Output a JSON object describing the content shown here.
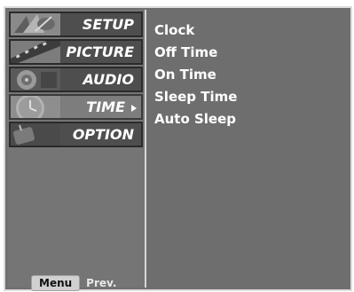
{
  "menu": {
    "items": [
      {
        "label": "SETUP",
        "icon": "satellite-dish-icon",
        "selected": false
      },
      {
        "label": "PICTURE",
        "icon": "film-strip-icon",
        "selected": false
      },
      {
        "label": "AUDIO",
        "icon": "speaker-icon",
        "selected": false
      },
      {
        "label": "TIME",
        "icon": "clock-icon",
        "selected": true
      },
      {
        "label": "OPTION",
        "icon": "special-icon",
        "selected": false
      }
    ]
  },
  "submenu": {
    "items": [
      "Clock",
      "Off Time",
      "On Time",
      "Sleep Time",
      "Auto Sleep"
    ]
  },
  "footer": {
    "menu_key": "Menu",
    "prev_label": "Prev."
  },
  "colors": {
    "background": "#6e6e6e",
    "selected_item": "#7d7d7d",
    "text": "#ffffff"
  }
}
